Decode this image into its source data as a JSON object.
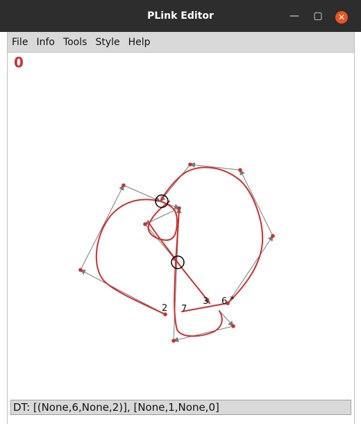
{
  "window": {
    "title": "PLink Editor",
    "minimize_glyph": "—",
    "maximize_glyph": "▢",
    "close_glyph": "✕"
  },
  "menu": {
    "items": [
      {
        "label": "File"
      },
      {
        "label": "Info"
      },
      {
        "label": "Tools"
      },
      {
        "label": "Style"
      },
      {
        "label": "Help"
      }
    ]
  },
  "canvas": {
    "counter": "0",
    "strand_labels": [
      "2",
      "7",
      "3",
      "6",
      "*"
    ]
  },
  "status": {
    "text": "DT: [(None,6,None,2)], [None,1,None,0]"
  },
  "colors": {
    "knot_stroke": "#cc2f2f",
    "vertex_fill": "#cc2f2f",
    "arrow_stroke": "#7a7a7a",
    "crossing_circle": "#000000",
    "counter_color": "#cf2e2e",
    "titlebar_bg": "#2d2d2d",
    "menubar_bg": "#d9d9d9",
    "close_button": "#e95420"
  },
  "icons": {
    "minimize": "minimize-icon",
    "maximize": "maximize-icon",
    "close": "close-icon"
  }
}
